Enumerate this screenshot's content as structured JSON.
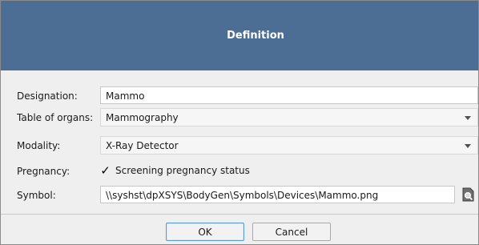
{
  "dialog": {
    "title": "Definition"
  },
  "form": {
    "designation": {
      "label": "Designation:",
      "value": "Mammo"
    },
    "table_of_organs": {
      "label": "Table of organs:",
      "value": "Mammography"
    },
    "modality": {
      "label": "Modality:",
      "value": "X-Ray Detector"
    },
    "pregnancy": {
      "label": "Pregnancy:",
      "checkbox_label": "Screening pregnancy status",
      "checked": true,
      "check_glyph": "✓"
    },
    "symbol": {
      "label": "Symbol:",
      "value": "\\\\syshst\\dpXSYS\\BodyGen\\Symbols\\Devices\\Mammo.png",
      "browse_icon": "file-search-icon"
    }
  },
  "buttons": {
    "ok": "OK",
    "cancel": "Cancel"
  },
  "colors": {
    "titlebar": "#4c6e94",
    "title_text": "#ffffff",
    "background": "#efefef",
    "ok_border": "#5b9bd5"
  }
}
